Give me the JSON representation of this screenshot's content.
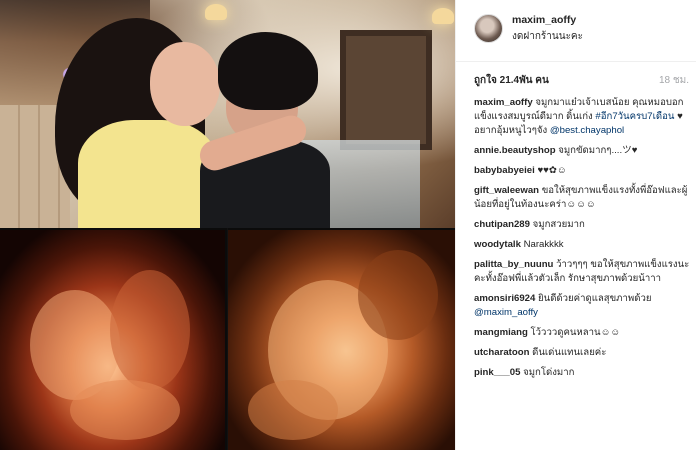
{
  "post": {
    "username": "maxim_aoffy",
    "location": "งดฝากร้านนะคะ",
    "likes": "ถูกใจ 21.4พัน คน",
    "time": "18 ชม."
  },
  "caption": {
    "user": "maxim_aoffy",
    "text": "จมูกมาแย๋วเจ้าเบสน้อย คุณหมอบอกแข็งแรงสมบูรณ์ดีมาก ดิ้นเก่ง",
    "hashtag": "#อีก7วันครบ7เดือน",
    "text2": "♥ อยากอุ้มหนูไวๆจัง",
    "mention": "@best.chayaphol"
  },
  "comments": [
    {
      "user": "annie.beautyshop",
      "text": "จมูกขัดมากๆ....ツ♥"
    },
    {
      "user": "babybabyeiei",
      "text": "♥♥✿☺"
    },
    {
      "user": "gift_waleewan",
      "text": "ขอให้สุขภาพแข็งแรงทั้งพี่อ๊อฟและผู้น้อยที่อยู่ในท้องนะคร่า☺☺☺"
    },
    {
      "user": "chutipan289",
      "text": "จมูกสวยมาก"
    },
    {
      "user": "woodytalk",
      "text": "Narakkkk"
    },
    {
      "user": "palitta_by_nuunu",
      "text": "ว้าวๆๆๆ ขอให้สุขภาพแข็งแรงนะคะทั้งอ๊อฟพี่แล้วตัวเล็ก รักษาสุขภาพด้วยน้าาา"
    },
    {
      "user": "amonsiri6924",
      "text": "ยินดีด้วยค่าดูแลสุขภาพด้วย",
      "mention": "@maxim_aoffy"
    },
    {
      "user": "mangmiang",
      "text": "โว้วววดูคนหลาน☺☺"
    },
    {
      "user": "utcharatoon",
      "text": "ดีนเด่นแทนเลยค่ะ"
    },
    {
      "user": "pink___05",
      "text": "จมูกโด่งมาก"
    }
  ]
}
